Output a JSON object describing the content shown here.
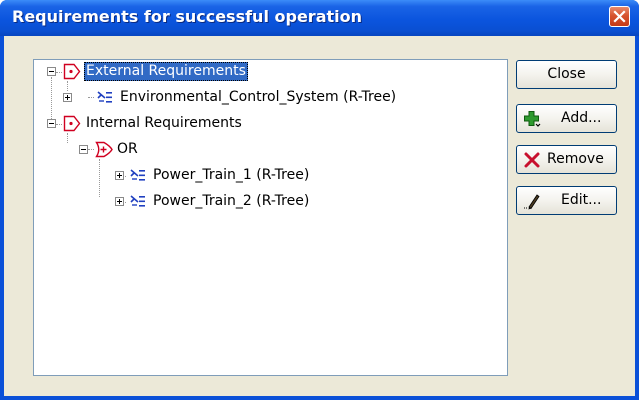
{
  "window": {
    "title": "Requirements for successful operation"
  },
  "tree": {
    "nodes": [
      {
        "label": "External Requirements",
        "selected": true,
        "icon": "requirement-group-icon"
      },
      {
        "label": "Environmental_Control_System (R-Tree)",
        "icon": "r-tree-icon"
      },
      {
        "label": "Internal Requirements",
        "icon": "requirement-group-icon"
      },
      {
        "label": "OR",
        "icon": "or-gate-icon"
      },
      {
        "label": "Power_Train_1 (R-Tree)",
        "icon": "r-tree-icon"
      },
      {
        "label": "Power_Train_2 (R-Tree)",
        "icon": "r-tree-icon"
      }
    ]
  },
  "buttons": {
    "close_label": "Close",
    "add_label": "Add...",
    "remove_label": "Remove",
    "edit_label": "Edit..."
  },
  "colors": {
    "titlebar": "#0a50d8",
    "selection": "#316ac5",
    "requirement_icon": "#d00020",
    "tree_icon": "#2040c0"
  }
}
